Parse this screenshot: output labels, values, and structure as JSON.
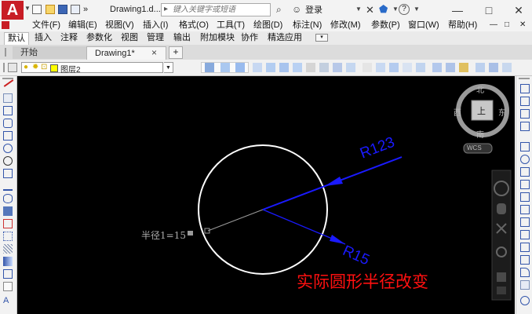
{
  "app": {
    "logo": "A",
    "doc_title": "Drawing1.d...",
    "quick_access_icons": [
      "new-icon",
      "open-icon",
      "save-icon",
      "saveas-icon",
      "undo-icon"
    ],
    "more_label": "»"
  },
  "search": {
    "placeholder": "键入关键字或短语"
  },
  "titlebar": {
    "login_label": "登录",
    "help_label": "?",
    "minimize": "—",
    "restore": "□",
    "close": "✕",
    "menu_min": "—",
    "menu_restore": "□",
    "menu_close": "✕"
  },
  "menu": {
    "items": [
      "文件(F)",
      "编辑(E)",
      "视图(V)",
      "插入(I)",
      "格式(O)",
      "工具(T)",
      "绘图(D)",
      "标注(N)",
      "修改(M)",
      "参数(P)",
      "窗口(W)",
      "帮助(H)"
    ]
  },
  "ribbon": {
    "tabs": [
      "默认",
      "插入",
      "注释",
      "参数化",
      "视图",
      "管理",
      "输出",
      "附加模块",
      "协作",
      "精选应用"
    ]
  },
  "doc_tabs": {
    "tabs": [
      "开始",
      "Drawing1*"
    ],
    "close": "×",
    "add": "+"
  },
  "properties": {
    "layer_name": "图层2"
  },
  "viewcube": {
    "north": "北",
    "south": "南",
    "west": "西",
    "east": "东",
    "top": "上",
    "wcs": "WCS"
  },
  "drawing": {
    "dim_large": "R123",
    "dim_small": "R15",
    "param_label": "半径1=15",
    "caption": "实际圆形半径改变",
    "colors": {
      "circle": "#ffffff",
      "dimension": "#1a1aff",
      "caption": "#ff0000",
      "background": "#000000"
    }
  }
}
